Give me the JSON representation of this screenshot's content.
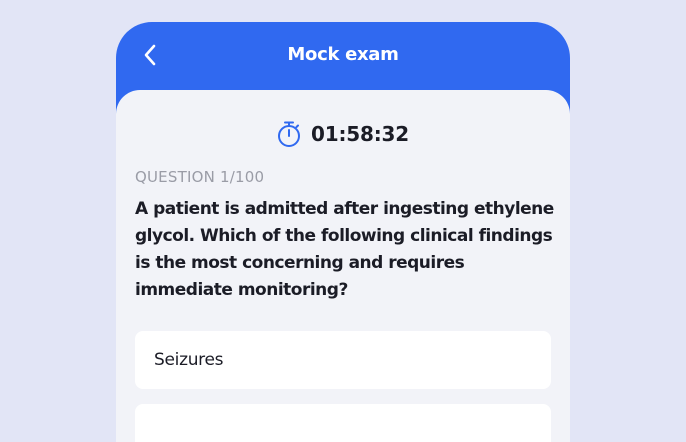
{
  "header": {
    "title": "Mock exam",
    "back_icon": "chevron-left-icon"
  },
  "timer": {
    "icon": "stopwatch-icon",
    "value": "01:58:32"
  },
  "question": {
    "number_label": "QUESTION 1/100",
    "text": "A patient is admitted after ingesting ethylene glycol. Which of the following clinical findings is the most concerning and requires immediate monitoring?"
  },
  "options": [
    {
      "label": "Seizures"
    },
    {
      "label": ""
    }
  ],
  "colors": {
    "background": "#e2e5f6",
    "header": "#3069f0",
    "content": "#f2f3f8",
    "card": "#ffffff",
    "accent": "#3069f0"
  }
}
